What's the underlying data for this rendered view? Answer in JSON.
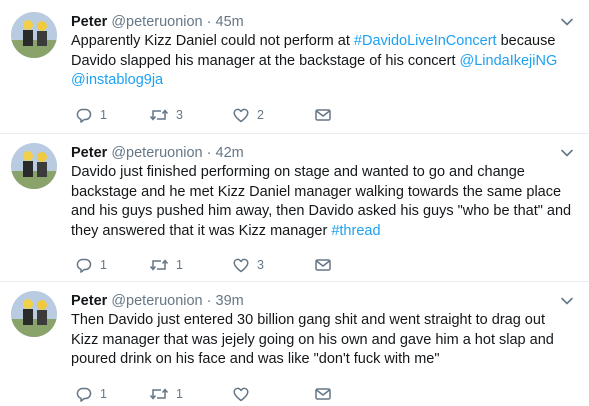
{
  "tweets": [
    {
      "name": "Peter",
      "handle": "@peteruonion",
      "dot": "·",
      "time": "45m",
      "text_a": "Apparently Kizz Daniel could not perform at ",
      "tag1": "#DavidoLiveInConcert",
      "text_b": " because Davido slapped his manager at the backstage of his concert ",
      "mention1": "@LindaIkejiNG",
      "text_c": " ",
      "mention2": "@instablog9ja",
      "replies": "1",
      "retweets": "3",
      "likes": "2"
    },
    {
      "name": "Peter",
      "handle": "@peteruonion",
      "dot": "·",
      "time": "42m",
      "text_a": "Davido just finished performing on stage and wanted to go and change backstage and he met Kizz Daniel manager walking towards the same place and his guys pushed him away, then Davido asked his guys \"who be that\" and they answered that it was Kizz manager ",
      "tag1": "#thread",
      "replies": "1",
      "retweets": "1",
      "likes": "3"
    },
    {
      "name": "Peter",
      "handle": "@peteruonion",
      "dot": "·",
      "time": "39m",
      "text_a": "Then Davido just entered 30 billion gang shit and went straight to drag out Kizz manager that was jejely going on his own and gave him a hot slap and poured drink on his face and was like \"don't fuck with me\"",
      "replies": "1",
      "retweets": "1",
      "likes": ""
    }
  ],
  "colors": {
    "link": "#1da1f2",
    "secondary": "#657786",
    "divider": "#e6ecf0"
  },
  "icons": [
    "reply-icon",
    "retweet-icon",
    "like-icon",
    "dm-icon",
    "chevron-down-icon"
  ]
}
